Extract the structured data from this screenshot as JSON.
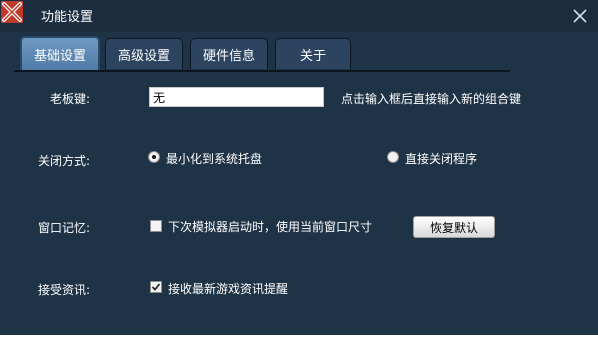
{
  "window": {
    "title": "功能设置",
    "logo_icon": "app-logo-x",
    "close_icon": "close-icon"
  },
  "tabs": [
    {
      "label": "基础设置",
      "active": true
    },
    {
      "label": "高级设置",
      "active": false
    },
    {
      "label": "硬件信息",
      "active": false
    },
    {
      "label": "关于",
      "active": false
    }
  ],
  "boss_key": {
    "label": "老板键:",
    "value": "无",
    "hint": "点击输入框后直接输入新的组合键"
  },
  "close_mode": {
    "label": "关闭方式:",
    "options": [
      {
        "label": "最小化到系统托盘",
        "selected": true
      },
      {
        "label": "直接关闭程序",
        "selected": false
      }
    ]
  },
  "window_memory": {
    "label": "窗口记忆:",
    "checkbox_label": "下次模拟器启动时，使用当前窗口尺寸",
    "checked": false,
    "restore_button": "恢复默认"
  },
  "news": {
    "label": "接受资讯:",
    "checkbox_label": "接收最新游戏资讯提醒",
    "checked": true
  },
  "colors": {
    "window_bg": "#1f3347",
    "titlebar_bg": "#1b2d3f",
    "active_tab": "#5f8ab5",
    "logo_red": "#c0392b"
  }
}
